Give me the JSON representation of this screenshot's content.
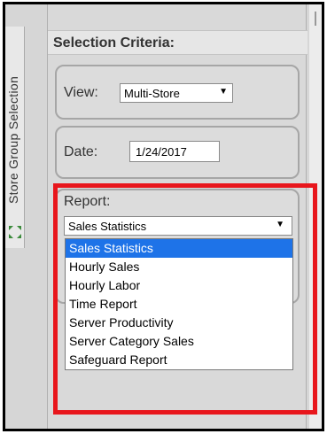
{
  "sidebar": {
    "tab_label": "Store Group Selection",
    "expand_icon": "expand-arrows-icon"
  },
  "panel": {
    "title": "Selection Criteria:",
    "view": {
      "label": "View:",
      "selected": "Multi-Store"
    },
    "date": {
      "label": "Date:",
      "value": "1/24/2017"
    },
    "report": {
      "label": "Report:",
      "selected": "Sales Statistics",
      "options": [
        "Sales Statistics",
        "Hourly Sales",
        "Hourly Labor",
        "Time Report",
        "Server Productivity",
        "Server Category Sales",
        "Safeguard Report"
      ]
    }
  },
  "colors": {
    "highlight": "#e8161c",
    "selected_option": "#1e73e8"
  }
}
